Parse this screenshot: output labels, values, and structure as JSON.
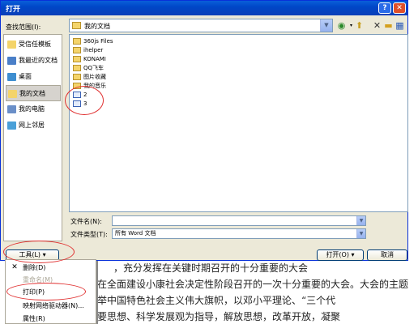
{
  "window": {
    "title": "打开",
    "help": "?",
    "close": "✕"
  },
  "lookin": {
    "label": "查找范围(I):",
    "value": "我的文档"
  },
  "places": [
    {
      "label": "受信任模板",
      "icon": "folder-icon",
      "color": "#f4d46a"
    },
    {
      "label": "我最近的文档",
      "icon": "recent-docs-icon",
      "color": "#4a7fc8"
    },
    {
      "label": "桌面",
      "icon": "desktop-icon",
      "color": "#3e8ed0"
    },
    {
      "label": "我的文档",
      "icon": "my-documents-icon",
      "color": "#f4d46a"
    },
    {
      "label": "我的电脑",
      "icon": "my-computer-icon",
      "color": "#6a8fc8"
    },
    {
      "label": "网上邻居",
      "icon": "network-icon",
      "color": "#4aa0d8"
    }
  ],
  "files": [
    {
      "name": "360js Files",
      "type": "folder"
    },
    {
      "name": "ihelper",
      "type": "folder"
    },
    {
      "name": "KONAMI",
      "type": "folder"
    },
    {
      "name": "QQ飞车",
      "type": "folder"
    },
    {
      "name": "图片收藏",
      "type": "folder"
    },
    {
      "name": "我的音乐",
      "type": "folder"
    },
    {
      "name": "2",
      "type": "word-doc"
    },
    {
      "name": "3",
      "type": "word-doc"
    }
  ],
  "filename": {
    "label": "文件名(N):",
    "value": ""
  },
  "filetype": {
    "label": "文件类型(T):",
    "value": "所有 Word 文档"
  },
  "buttons": {
    "tools": "工具(L)",
    "open": "打开(O)",
    "cancel": "取消"
  },
  "menu": [
    {
      "label": "删除(D)",
      "icon": "✕",
      "disabled": false
    },
    {
      "label": "重命名(M)",
      "icon": "",
      "disabled": true
    },
    {
      "label": "打印(P)",
      "icon": "",
      "disabled": false
    },
    {
      "label": "映射网络驱动器(N)...",
      "icon": "",
      "disabled": false
    },
    {
      "label": "属性(R)",
      "icon": "",
      "disabled": false
    }
  ],
  "document_lines": [
    "，充分发挥在关键时期召开的十分重要的大会",
    "在全面建设小康社会决定性阶段召开的一次十分重要的大会。大会的主题",
    "举中国特色社会主义伟大旗帜，以邓小平理论、“三个代",
    "要思想、科学发展观为指导，解放思想，改革开放，凝聚"
  ],
  "colors": {
    "annotation": "#e03030",
    "titlebar": "#0a5fd9"
  }
}
